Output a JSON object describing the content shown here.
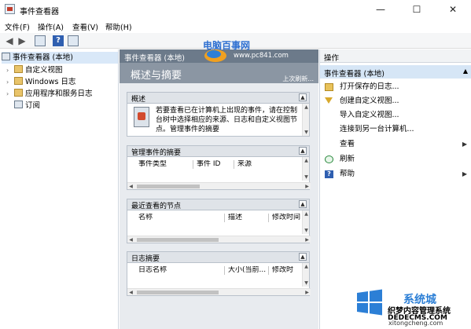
{
  "window": {
    "title": "事件查看器",
    "minimize": "—",
    "maximize": "☐",
    "close": "✕"
  },
  "menu": [
    "文件(F)",
    "操作(A)",
    "查看(V)",
    "帮助(H)"
  ],
  "tree": [
    {
      "label": "事件查看器 (本地)",
      "chevron": "",
      "selected": true
    },
    {
      "label": "自定义视图",
      "chevron": "›"
    },
    {
      "label": "Windows 日志",
      "chevron": "›"
    },
    {
      "label": "应用程序和服务日志",
      "chevron": "›"
    },
    {
      "label": "订阅",
      "chevron": ""
    }
  ],
  "middle": {
    "header": "事件查看器 (本地)",
    "banner_title": "概述与摘要",
    "banner_right": "上次刷新...",
    "overview_title": "概述",
    "overview_text": "若要查看已在计算机上出现的事件，请在控制台树中选择相应的来源、日志和自定义视图节点。管理事件的摘要",
    "admin_title": "管理事件的摘要",
    "admin_cols": [
      "事件类型",
      "事件 ID",
      "来源"
    ],
    "recent_title": "最近查看的节点",
    "recent_cols": [
      "名称",
      "描述",
      "修改时间"
    ],
    "logs_title": "日志摘要",
    "logs_cols": [
      "日志名称",
      "大小(当前...",
      "修改时"
    ]
  },
  "actions": {
    "header": "操作",
    "group": "事件查看器 (本地)",
    "items": [
      {
        "label": "打开保存的日志...",
        "icon": "open"
      },
      {
        "label": "创建自定义视图...",
        "icon": "filter"
      },
      {
        "label": "导入自定义视图...",
        "icon": ""
      },
      {
        "label": "连接到另一台计算机...",
        "icon": ""
      },
      {
        "label": "查看",
        "icon": "",
        "sub": "▶"
      },
      {
        "label": "刷新",
        "icon": "refresh"
      },
      {
        "label": "帮助",
        "icon": "help",
        "sub": "▶"
      }
    ]
  },
  "watermarks": {
    "top_name": "电脑百事网",
    "top_url": "www.pc841.com",
    "brand": "系统城",
    "brand_sub": "织梦内容管理系统",
    "brand_url": "DEDECMS.COM",
    "brand_bottom": "xitongcheng.com"
  }
}
